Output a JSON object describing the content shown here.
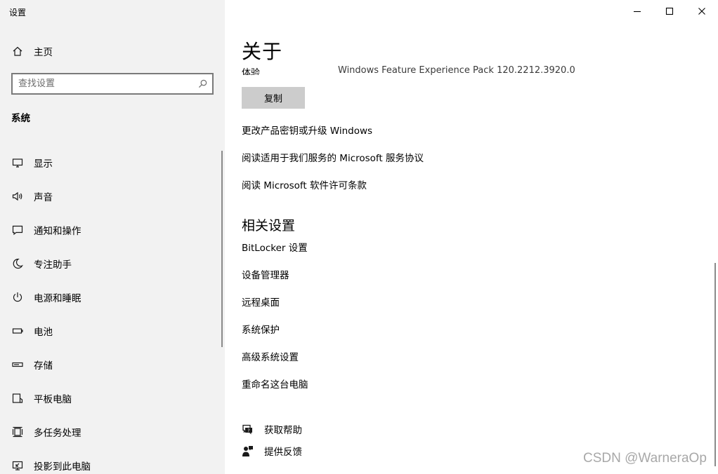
{
  "window": {
    "title": "设置",
    "controls": {
      "minimize_icon": "minimize-icon",
      "maximize_icon": "maximize-icon",
      "close_icon": "close-icon"
    }
  },
  "sidebar": {
    "home_label": "主页",
    "search_placeholder": "查找设置",
    "section_heading": "系统",
    "items": [
      {
        "label": "显示",
        "icon": "display-icon"
      },
      {
        "label": "声音",
        "icon": "speaker-icon"
      },
      {
        "label": "通知和操作",
        "icon": "notification-icon"
      },
      {
        "label": "专注助手",
        "icon": "moon-icon"
      },
      {
        "label": "电源和睡眠",
        "icon": "power-icon"
      },
      {
        "label": "电池",
        "icon": "battery-icon"
      },
      {
        "label": "存储",
        "icon": "storage-icon"
      },
      {
        "label": "平板电脑",
        "icon": "tablet-icon"
      },
      {
        "label": "多任务处理",
        "icon": "multitask-icon"
      },
      {
        "label": "投影到此电脑",
        "icon": "project-icon"
      }
    ]
  },
  "main": {
    "title": "关于",
    "experience_label": "体验",
    "experience_value": "Windows Feature Experience Pack 120.2212.3920.0",
    "copy_button": "复制",
    "links": [
      "更改产品密钥或升级 Windows",
      "阅读适用于我们服务的 Microsoft 服务协议",
      "阅读 Microsoft 软件许可条款"
    ],
    "related_title": "相关设置",
    "related_links": [
      "BitLocker 设置",
      "设备管理器",
      "远程桌面",
      "系统保护",
      "高级系统设置",
      "重命名这台电脑"
    ],
    "help": [
      {
        "label": "获取帮助",
        "icon": "help-chat-icon"
      },
      {
        "label": "提供反馈",
        "icon": "feedback-icon"
      }
    ]
  },
  "watermark": "CSDN @WarneraOp"
}
